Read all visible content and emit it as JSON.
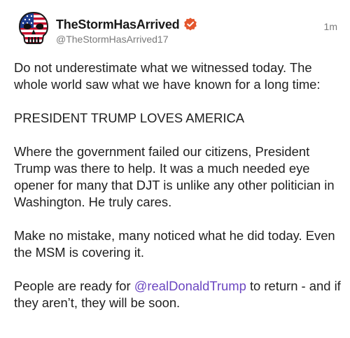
{
  "author": {
    "display_name": "TheStormHasArrived",
    "handle": "@TheStormHasArrived17",
    "verified": true,
    "avatar_icon": "punisher-skull-flag-icon"
  },
  "post": {
    "timestamp": "1m",
    "paragraphs": [
      {
        "text": "Do not underestimate what we witnessed today. The whole world saw what we have known for a long time:"
      },
      {
        "text": "PRESIDENT TRUMP LOVES AMERICA"
      },
      {
        "text": "Where the government failed our citizens, President Trump was there to help. It was a much needed eye opener for many that DJT is unlike any other politician in Washington. He truly cares."
      },
      {
        "text": "Make no mistake, many noticed what he did today. Even the MSM is covering it."
      }
    ],
    "last_paragraph": {
      "before": "People are ready for ",
      "mention": "@realDonaldTrump",
      "after": " to return - and if they aren’t, they will be soon."
    }
  },
  "colors": {
    "mention": "#6b46c1",
    "verified_badge": "#e4572e",
    "secondary_text": "#7a7a7a"
  }
}
